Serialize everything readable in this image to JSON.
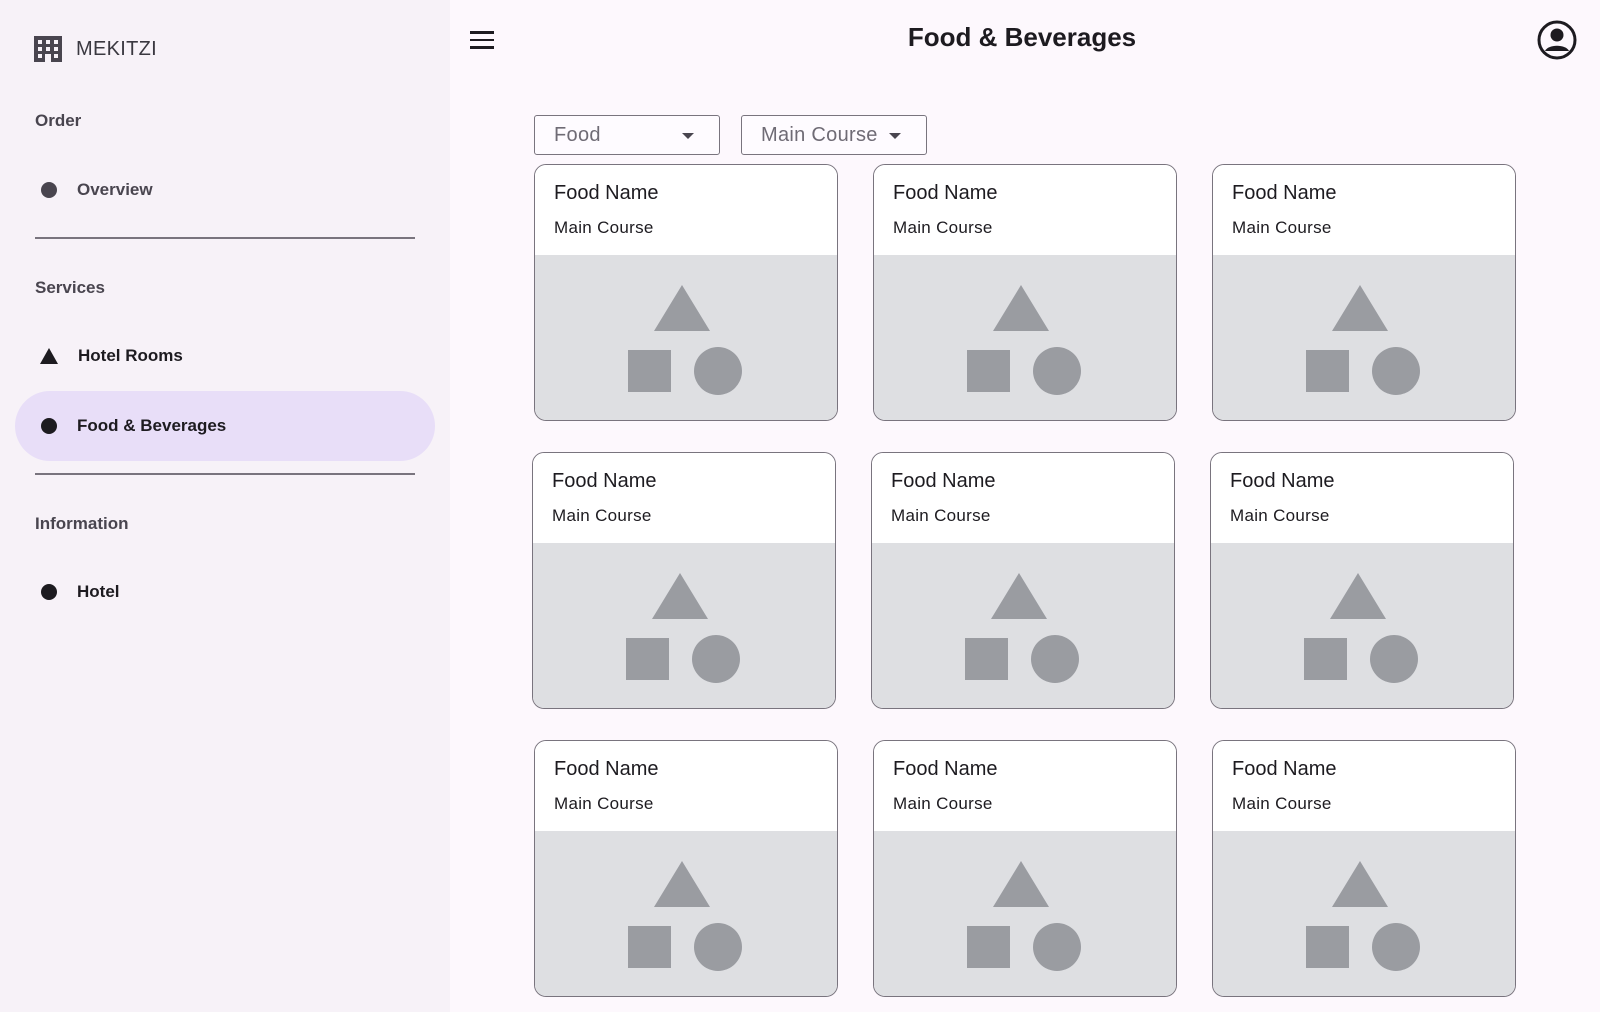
{
  "app": {
    "brand": "MEKITZI",
    "title": "Food & Beverages"
  },
  "sidebar": {
    "sections": [
      {
        "title": "Order",
        "items": [
          {
            "label": "Overview",
            "icon": "circle-icon",
            "active": false
          }
        ]
      },
      {
        "title": "Services",
        "items": [
          {
            "label": "Hotel Rooms",
            "icon": "triangle-icon",
            "active": false
          },
          {
            "label": "Food & Beverages",
            "icon": "circle-icon",
            "active": true
          }
        ]
      },
      {
        "title": "Information",
        "items": [
          {
            "label": "Hotel",
            "icon": "circle-icon",
            "active": false
          }
        ]
      }
    ]
  },
  "filters": {
    "category": {
      "value": "Food"
    },
    "course": {
      "value": "Main Course"
    }
  },
  "cards": [
    {
      "title": "Food Name",
      "subtitle": "Main Course"
    },
    {
      "title": "Food Name",
      "subtitle": "Main Course"
    },
    {
      "title": "Food Name",
      "subtitle": "Main Course"
    },
    {
      "title": "Food Name",
      "subtitle": "Main Course"
    },
    {
      "title": "Food Name",
      "subtitle": "Main Course"
    },
    {
      "title": "Food Name",
      "subtitle": "Main Course"
    },
    {
      "title": "Food Name",
      "subtitle": "Main Course"
    },
    {
      "title": "Food Name",
      "subtitle": "Main Course"
    },
    {
      "title": "Food Name",
      "subtitle": "Main Course"
    }
  ],
  "colors": {
    "background": "#fdf8fd",
    "sidebar": "#f7f2f8",
    "active_nav": "#e8def8",
    "placeholder": "#dedfe2",
    "placeholder_shape": "#9a9ca1"
  }
}
